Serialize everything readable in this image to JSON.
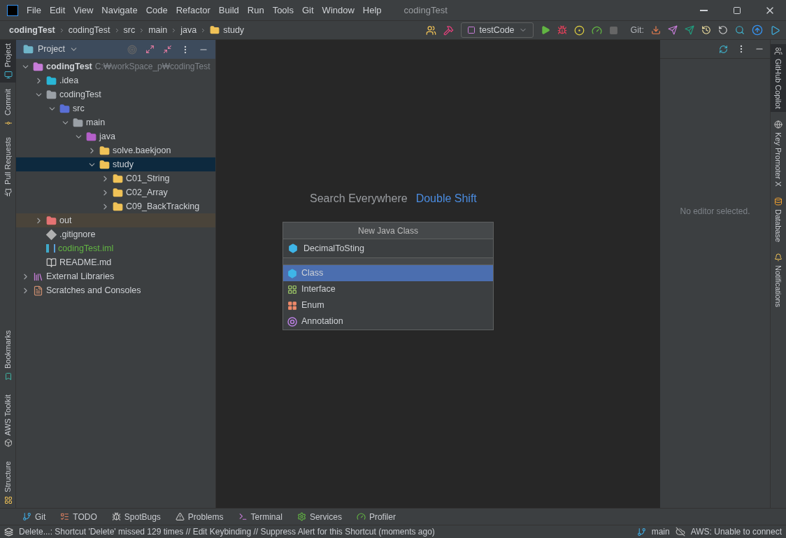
{
  "window_title": "codingTest",
  "menu": [
    "File",
    "Edit",
    "View",
    "Navigate",
    "Code",
    "Refactor",
    "Build",
    "Run",
    "Tools",
    "Git",
    "Window",
    "Help"
  ],
  "breadcrumbs": [
    {
      "label": "codingTest",
      "kind": "project"
    },
    {
      "label": "codingTest",
      "kind": "plain"
    },
    {
      "label": "src",
      "kind": "plain"
    },
    {
      "label": "main",
      "kind": "plain"
    },
    {
      "label": "java",
      "kind": "plain"
    },
    {
      "label": "study",
      "kind": "folder"
    }
  ],
  "toolbar": {
    "run_config": "testCode",
    "git_label": "Git:"
  },
  "left_stripe_top": [
    {
      "label": "Project",
      "kind": "project",
      "selected": true
    },
    {
      "label": "Commit",
      "kind": "commit",
      "selected": false
    },
    {
      "label": "Pull Requests",
      "kind": "github",
      "selected": false
    }
  ],
  "left_stripe_bottom": [
    {
      "label": "Bookmarks",
      "kind": "bookmarks",
      "selected": false
    },
    {
      "label": "AWS Toolkit",
      "kind": "aws",
      "selected": false
    },
    {
      "label": "Structure",
      "kind": "structure",
      "selected": false
    }
  ],
  "right_stripe": [
    {
      "label": "GitHub Copilot",
      "kind": "copilot",
      "selected": true
    },
    {
      "label": "Key Promoter X",
      "kind": "globe",
      "selected": false
    },
    {
      "label": "Database",
      "kind": "database",
      "selected": false
    },
    {
      "label": "Notifications",
      "kind": "bell",
      "selected": false
    }
  ],
  "project_panel": {
    "title": "Project",
    "tree": [
      {
        "label": "codingTest",
        "kind": "module",
        "hint": "C:₩workSpace_p₩codingTest",
        "expanded": true,
        "selected": false,
        "children": [
          {
            "label": ".idea",
            "kind": "idea",
            "expanded": false,
            "selected": false
          },
          {
            "label": "codingTest",
            "kind": "folder-grey",
            "expanded": true,
            "selected": false,
            "children": [
              {
                "label": "src",
                "kind": "src",
                "expanded": true,
                "selected": false,
                "children": [
                  {
                    "label": "main",
                    "kind": "folder-grey",
                    "expanded": true,
                    "selected": false,
                    "children": [
                      {
                        "label": "java",
                        "kind": "java-root",
                        "expanded": true,
                        "selected": false,
                        "children": [
                          {
                            "label": "solve.baekjoon",
                            "kind": "package",
                            "expanded": false,
                            "selected": false
                          },
                          {
                            "label": "study",
                            "kind": "package",
                            "expanded": true,
                            "selected": true,
                            "children": [
                              {
                                "label": "C01_String",
                                "kind": "package",
                                "expanded": false,
                                "selected": false
                              },
                              {
                                "label": "C02_Array",
                                "kind": "package",
                                "expanded": false,
                                "selected": false
                              },
                              {
                                "label": "C09_BackTracking",
                                "kind": "package",
                                "expanded": false,
                                "selected": false
                              }
                            ]
                          }
                        ]
                      }
                    ]
                  }
                ]
              }
            ]
          },
          {
            "label": "out",
            "kind": "excluded",
            "expanded": false,
            "selected": false
          },
          {
            "label": ".gitignore",
            "kind": "gitignore",
            "selected": false
          },
          {
            "label": "codingTest.iml",
            "kind": "iml",
            "selected": false
          },
          {
            "label": "README.md",
            "kind": "markdown",
            "selected": false
          }
        ]
      },
      {
        "label": "External Libraries",
        "kind": "library",
        "expanded": false,
        "selected": false
      },
      {
        "label": "Scratches and Consoles",
        "kind": "scratches",
        "expanded": false,
        "selected": false
      }
    ]
  },
  "editor": {
    "hint_label": "Search Everywhere",
    "hint_shortcut": "Double Shift"
  },
  "popup": {
    "title": "New Java Class",
    "value": "DecimalToSting",
    "items": [
      {
        "label": "Class",
        "kind": "class",
        "selected": true
      },
      {
        "label": "Interface",
        "kind": "interface",
        "selected": false
      },
      {
        "label": "Enum",
        "kind": "enum",
        "selected": false
      },
      {
        "label": "Annotation",
        "kind": "annotation",
        "selected": false
      }
    ]
  },
  "right_panel": {
    "message": "No editor selected."
  },
  "bottom_tools": [
    {
      "label": "Git",
      "kind": "git"
    },
    {
      "label": "TODO",
      "kind": "todo"
    },
    {
      "label": "SpotBugs",
      "kind": "bug"
    },
    {
      "label": "Problems",
      "kind": "problems"
    },
    {
      "label": "Terminal",
      "kind": "terminal"
    },
    {
      "label": "Services",
      "kind": "services"
    },
    {
      "label": "Profiler",
      "kind": "profiler"
    }
  ],
  "status": {
    "message": "Delete...: Shortcut 'Delete' missed 129 times // Edit Keybinding // Suppress Alert for this Shortcut (moments ago)",
    "branch": "main",
    "aws": "AWS: Unable to connect"
  }
}
